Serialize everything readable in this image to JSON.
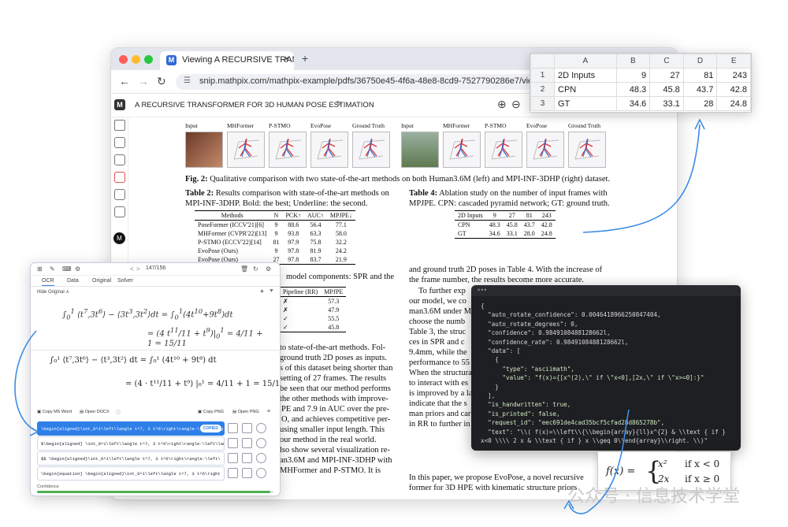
{
  "browser": {
    "tab_title": "Viewing A RECURSIVE TRAN",
    "tab_close": "×",
    "new_tab": "+",
    "url": "snip.mathpix.com/mathpix-example/pdfs/36750e45-4f6a-48e8-8cd9-7527790286e7/view",
    "back": "←",
    "forward": "→",
    "reload": "↻"
  },
  "app": {
    "doc_title": "A RECURSIVE TRANSFORMER FOR 3D HUMAN POSE ESTIMATION",
    "zoom_in": "⊕",
    "zoom_out": "⊖",
    "avatar": "M"
  },
  "paper": {
    "fig_headers_left": [
      "Input",
      "MHFormer",
      "P-STMO",
      "EvoPose",
      "Ground Truth"
    ],
    "fig_headers_right": [
      "Input",
      "MHFormer",
      "P-STMO",
      "EvoPose",
      "Ground Truth"
    ],
    "fig_caption_bold": "Fig. 2:",
    "fig_caption": " Qualitative comparison with two state-of-the-art methods on both Human3.6M (left) and MPI-INF-3DHP (right) dataset.",
    "t2_cap_bold": "Table 2:",
    "t2_cap_1": " Results comparison with state-of-the-art methods on",
    "t2_cap_2": "MPI-INF-3DHP. Bold: the best; Underline: the second.",
    "t2_head": [
      "Methods",
      "N",
      "PCK↑",
      "AUC↑",
      "MPJPE↓"
    ],
    "t2_rows": [
      [
        "PoseFormer (ICCV'21)[6]",
        "9",
        "88.6",
        "56.4",
        "77.1"
      ],
      [
        "MHFormer (CVPR'22)[13]",
        "9",
        "93.8",
        "63.3",
        "58.0"
      ],
      [
        "P-STMO (ECCV'22)[14]",
        "81",
        "97.9",
        "75.8",
        "32.2"
      ],
      [
        "EvoPose (Ours)",
        "9",
        "97.8",
        "81.9",
        "24.2"
      ],
      [
        "EvoPose (Ours)",
        "27",
        "97.8",
        "83.7",
        "21.9"
      ]
    ],
    "t4_cap_bold": "Table 4:",
    "t4_cap_1": " Ablation study on the number of input frames with",
    "t4_cap_2": "MPJPE. CPN: cascaded pyramid network; GT: ground truth.",
    "t4_head": [
      "2D Inputs",
      "9",
      "27",
      "81",
      "243"
    ],
    "t4_rows": [
      [
        "CPN",
        "48.3",
        "45.8",
        "43.7",
        "42.8"
      ],
      [
        "GT",
        "34.6",
        "33.1",
        "28.0",
        "24.8"
      ]
    ],
    "right_p1": "and ground truth 2D poses in Table 4. With the increase of",
    "right_p2": "the frame number, the results become more accurate.",
    "right_p3": "To further exp",
    "right_lines": [
      "our model, we co",
      "man3.6M under M",
      "choose the numb",
      "Table 3, the struc",
      "ces in SPR and c",
      "9.4mm, while the",
      "performance to 55",
      "When the structura",
      "to interact with es",
      "is improved by a la",
      "indicate that the s",
      "man priors and car",
      "in RR to further in"
    ],
    "right_p4": "In this paper, we propose EvoPose, a novel recursive",
    "right_p5": "former for 3D HPE with kinematic structure priors",
    "left_frag_1": "model components: SPR and the",
    "t3_head": [
      "Pipeline (RR)",
      "MPJPE"
    ],
    "t3_rows": [
      [
        "✗",
        "57.3"
      ],
      [
        "✗",
        "47.9"
      ],
      [
        "✓",
        "55.5"
      ],
      [
        "✓",
        "45.8"
      ]
    ],
    "left_lines": [
      "to state-of-the-art methods. Fol-",
      "ground truth 2D poses as inputs.",
      "s of this dataset being shorter than",
      "setting of 27 frames. The results",
      "be seen that our method performs",
      "the other methods with improve-",
      "PE and 7.9 in AUC over the pre-",
      "O, and achieves competitive per-",
      "using smaller input length. This",
      "our method in the real world.",
      "lso show several visualization re-",
      "an3.6M and MPI-INF-3DHP with",
      "MHFormer and P-STMO. It is"
    ]
  },
  "sheet": {
    "cols": [
      "",
      "A",
      "B",
      "C",
      "D",
      "E"
    ],
    "rows": [
      [
        "1",
        "2D Inputs",
        "9",
        "27",
        "81",
        "243"
      ],
      [
        "2",
        "CPN",
        "48.3",
        "45.8",
        "43.7",
        "42.8"
      ],
      [
        "3",
        "GT",
        "34.6",
        "33.1",
        "28",
        "24.8"
      ]
    ]
  },
  "ocr": {
    "page_indicator": "147/156",
    "tabs": [
      "OCR",
      "Data",
      "Original",
      "Solver"
    ],
    "hide_original": "Hide Original ∧",
    "copy_ms_word": "Copy MS Word",
    "open_docx": "Open DOCX",
    "copy_png": "Copy PNG",
    "open_png": "Open PNG",
    "copied": "COPIED",
    "results": [
      "\\begin{aligned}\\int_0^1\\left\\langle t^7, 3 t^6\\right\\rangle-\\left\\langle",
      "$\\begin{aligned} \\int_0^1\\left\\langle t^7, 3 t^6\\right\\rangle-\\left\\langle",
      "$$ \\begin{aligned}\\int_0^1\\left\\langle t^7, 3 t^6\\right\\rangle-\\left\\",
      "\\begin{equation} \\begin{aligned}\\int_0^1\\left\\langle t^7, 3 t^6\\right"
    ],
    "confidence_label": "Confidence",
    "confidence": 0.985,
    "math_line1": "∫₀¹ ⟨t⁷,3t⁶⟩ − ⟨t³,3t²⟩ dt = ∫₀¹ (4t¹⁰ + 9t⁸) dt",
    "math_line2": "= (4 · t¹¹/11 + t⁹) |₀¹ = 4/11 + 1 = 15/11"
  },
  "json_view": {
    "lines": [
      "{",
      "  \"auto_rotate_confidence\": 0.0046418966250847404,",
      "  \"auto_rotate_degrees\": 0,",
      "  \"confidence\": 0.9849108488128662l,",
      "  \"confidence_rate\": 0.9849108488128662l,",
      "  \"data\": [",
      "    {",
      "      \"type\": \"asciimath\",",
      "      \"value\": \"f(x)={[x^(2),\\\" if \\\"x<0],[2x,\\\" if \\\"x>=0]:}\"",
      "    }",
      "  ],",
      "  \"is_handwritten\": true,",
      "  \"is_printed\": false,",
      "  \"request_id\": \"eec691de4cad35bcf5cfad28d865278b\",",
      "  \"text\": \"\\\\( f(x)=\\\\left\\\\{\\\\begin{array}{ll}x^{2} & \\\\text { if }",
      "x<0 \\\\\\\\ 2 x & \\\\text { if } x \\\\geq 0\\\\end{array}\\\\right. \\\\)\""
    ]
  },
  "mathbox": {
    "fx": "f(x) =",
    "r1a": "x²",
    "r1b": "if x < 0",
    "r2a": "2x",
    "r2b": "if x ≥ 0"
  },
  "watermark": "公众号 · 信息技术学堂",
  "colors": {
    "accent": "#2f7fe8",
    "arrow": "#3d8de6",
    "confidence_bar": "#4caf50"
  }
}
